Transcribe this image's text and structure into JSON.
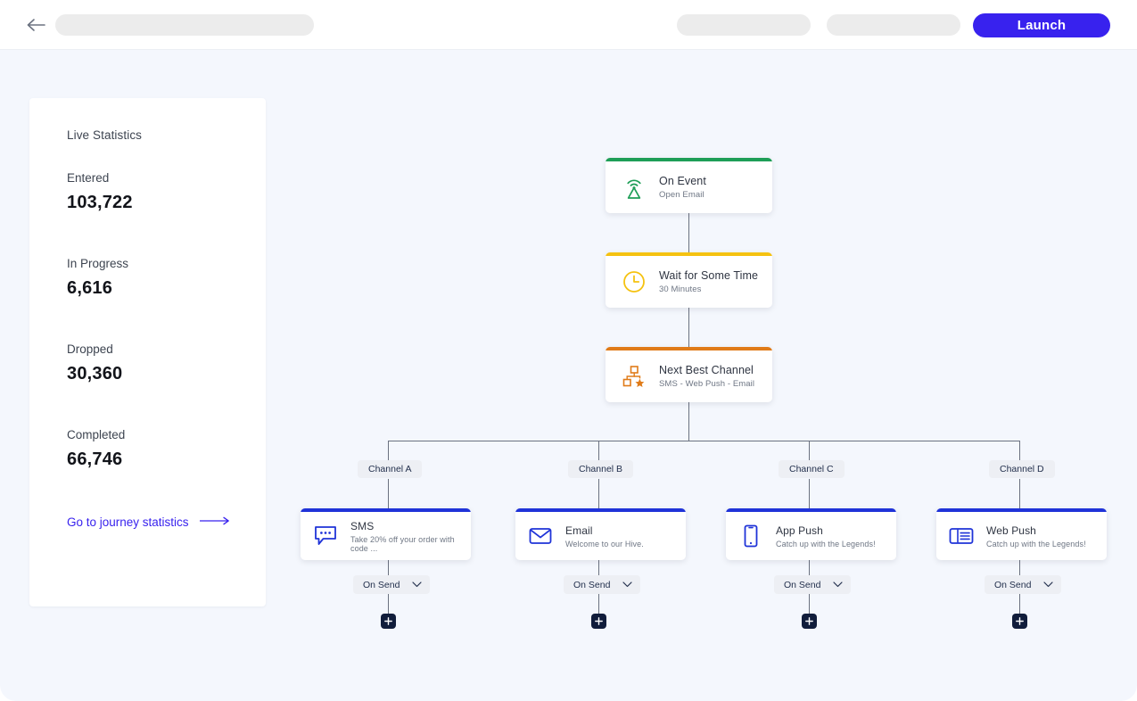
{
  "topbar": {
    "back_icon": "arrow-left-icon",
    "launch_label": "Launch",
    "accent_color": "#3822EE"
  },
  "stats": {
    "title": "Live Statistics",
    "items": [
      {
        "label": "Entered",
        "value": "103,722"
      },
      {
        "label": "In Progress",
        "value": "6,616"
      },
      {
        "label": "Dropped",
        "value": "30,360"
      },
      {
        "label": "Completed",
        "value": "66,746"
      }
    ],
    "link_label": "Go to journey statistics",
    "link_color": "#3822EE"
  },
  "flow": {
    "nodes": [
      {
        "title": "On Event",
        "sub": "Open Email",
        "icon": "broadcast-icon",
        "accent": "#1E9E57"
      },
      {
        "title": "Wait for Some Time",
        "sub": "30 Minutes",
        "icon": "clock-icon",
        "accent": "#F5C211"
      },
      {
        "title": "Next Best Channel",
        "sub": "SMS - Web Push - Email",
        "icon": "hierarchy-star-icon",
        "accent": "#E07B18"
      }
    ],
    "branches": [
      {
        "pill": "Channel A",
        "title": "SMS",
        "sub": "Take 20% off your order with code ...",
        "icon": "chat-bubble-icon",
        "accent": "#1F33D8",
        "trigger": "On Send",
        "add_label": "+"
      },
      {
        "pill": "Channel B",
        "title": "Email",
        "sub": "Welcome to our Hive.",
        "icon": "envelope-icon",
        "accent": "#1F33D8",
        "trigger": "On Send",
        "add_label": "+"
      },
      {
        "pill": "Channel C",
        "title": "App Push",
        "sub": "Catch up with the Legends!",
        "icon": "mobile-phone-icon",
        "accent": "#1F33D8",
        "trigger": "On Send",
        "add_label": "+"
      },
      {
        "pill": "Channel D",
        "title": "Web Push",
        "sub": "Catch up with the Legends!",
        "icon": "browser-window-icon",
        "accent": "#1F33D8",
        "trigger": "On Send",
        "add_label": "+"
      }
    ]
  }
}
